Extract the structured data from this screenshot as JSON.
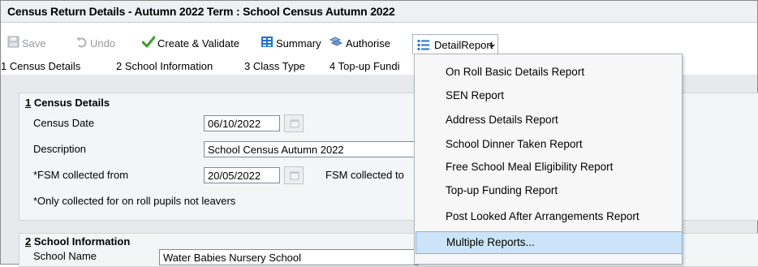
{
  "window": {
    "title": "Census Return Details - Autumn 2022 Term : School Census Autumn 2022"
  },
  "toolbar": {
    "save": "Save",
    "undo": "Undo",
    "create_validate": "Create & Validate",
    "summary": "Summary",
    "authorise": "Authorise",
    "detail_report": "DetailReport"
  },
  "tabs": [
    "1 Census Details",
    "2 School Information",
    "3 Class Type",
    "4 Top-up Fundi"
  ],
  "census_details": {
    "heading_num": "1",
    "heading_text": " Census Details",
    "census_date_label": "Census Date",
    "census_date_value": "06/10/2022",
    "description_label": "Description",
    "description_value": "School Census Autumn 2022",
    "fsm_from_label": "*FSM collected from",
    "fsm_from_value": "20/05/2022",
    "fsm_to_label": "FSM collected to",
    "note": "*Only collected for on roll pupils not leavers"
  },
  "school_information": {
    "heading_num": "2",
    "heading_text": " School Information",
    "school_name_label": "School Name",
    "school_name_value": "Water Babies Nursery School"
  },
  "detail_report_menu": {
    "items": [
      "On Roll Basic Details Report",
      "SEN Report",
      "Address Details Report",
      "School Dinner Taken Report",
      "Free School Meal Eligibility Report",
      "Top-up Funding Report",
      "Post Looked After Arrangements Report",
      "Multiple Reports..."
    ],
    "highlighted": "Multiple Reports..."
  },
  "colors": {
    "menu_highlight": "#cce4f7",
    "menu_highlight_border": "#7fb4e6",
    "content_bg": "#e7e9ec",
    "accent_blue": "#1e73d8",
    "accent_green": "#3a9b28"
  },
  "icons": {
    "save": "floppy-disk-icon",
    "undo": "undo-arrow-icon",
    "create_validate": "green-check-icon",
    "summary": "summary-grid-icon",
    "authorise": "authorise-icon",
    "detail_report": "list-icon",
    "dropdown": "caret-down-icon",
    "calendar": "calendar-icon"
  }
}
